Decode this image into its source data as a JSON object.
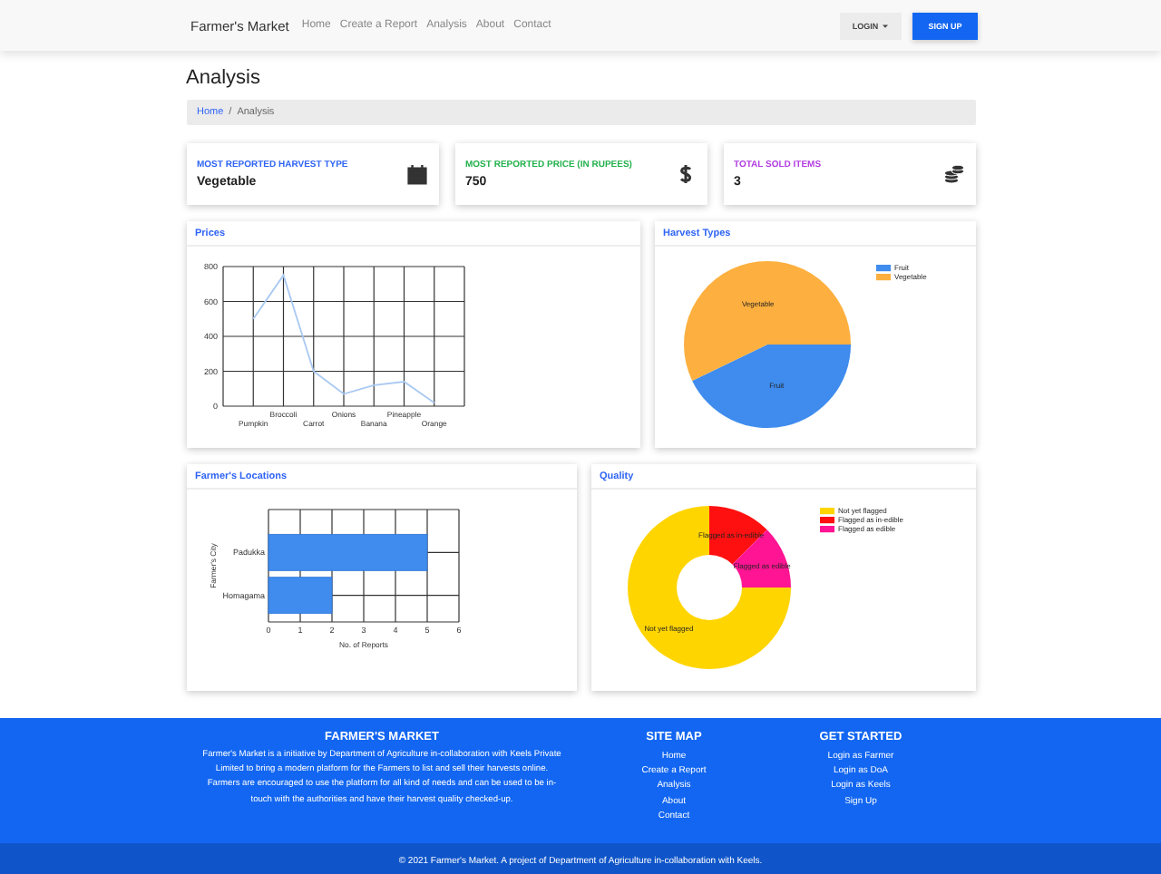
{
  "navbar": {
    "brand": "Farmer's Market",
    "links": [
      "Home",
      "Create a Report",
      "Analysis",
      "About",
      "Contact"
    ],
    "login": "LOGIN",
    "signup": "SIGN UP"
  },
  "page_title": "Analysis",
  "breadcrumb": {
    "separator": "/",
    "items": [
      {
        "label": "Home",
        "active": false
      },
      {
        "label": "Analysis",
        "active": true
      }
    ]
  },
  "stats": [
    {
      "label": "MOST REPORTED HARVEST TYPE",
      "value": "Vegetable",
      "color": "#2f64f5"
    },
    {
      "label": "MOST REPORTED PRICE (IN RUPEES)",
      "value": "750",
      "color": "#22b14c"
    },
    {
      "label": "TOTAL SOLD ITEMS",
      "value": "3",
      "color": "#b23ce0"
    }
  ],
  "prices": {
    "title": "Prices",
    "chart_data": {
      "type": "line",
      "categories": [
        "Pumpkin",
        "Broccoli",
        "Carrot",
        "Onions",
        "Banana",
        "Pineapple",
        "Orange"
      ],
      "series": [
        {
          "color": "#a9c9f2",
          "values": [
            500,
            750,
            200,
            70,
            120,
            140,
            20
          ]
        }
      ],
      "ylim": [
        0,
        800
      ],
      "yticks": [
        0,
        200,
        400,
        600,
        800
      ],
      "grid": true
    }
  },
  "harvest_types": {
    "title": "Harvest Types",
    "chart_data": {
      "type": "pie",
      "categories": [
        "Fruit",
        "Vegetable"
      ],
      "values": [
        42.86,
        57.14
      ],
      "colors": [
        "#3f8cee",
        "#fdb03f"
      ],
      "legend": true
    },
    "slice_labels": [
      "Fruit",
      "Vegetable"
    ]
  },
  "locations": {
    "title": "Farmer's Locations",
    "chart_data": {
      "type": "bar",
      "orientation": "horizontal",
      "categories": [
        "Padukka",
        "Homagama"
      ],
      "series": [
        {
          "color": "#3f8cee",
          "values": [
            5,
            2
          ]
        }
      ],
      "xlabel": "No. of Reports",
      "ylabel": "Farmer's City",
      "xlim": [
        0,
        6
      ],
      "xticks": [
        0,
        1,
        2,
        3,
        4,
        5,
        6
      ],
      "grid": true
    }
  },
  "quality": {
    "title": "Quality",
    "chart_data": {
      "type": "donut",
      "categories": [
        "Not yet flagged",
        "Flagged as in-edible",
        "Flagged as edible"
      ],
      "values": [
        75,
        12.5,
        12.5
      ],
      "colors": [
        "#ffd500",
        "#ff1010",
        "#ff1493"
      ],
      "legend": true
    },
    "slice_labels": [
      "Not yet flagged",
      "Flagged as in-edible",
      "Flagged as edible"
    ]
  },
  "footer": {
    "about": {
      "title": "FARMER'S MARKET",
      "text": "Farmer's Market is a initiative by Department of Agriculture in-collaboration with Keels Private Limited to bring a modern platform for the Farmers to list and sell their harvests online. Farmers are encouraged to use the platform for all kind of needs and can be used to be in-touch with the authorities and have their harvest quality checked-up."
    },
    "site_map": {
      "title": "SITE MAP",
      "links": [
        "Home",
        "Create a Report",
        "Analysis",
        "About",
        "Contact"
      ]
    },
    "get_started": {
      "title": "GET STARTED",
      "links": [
        "Login as Farmer",
        "Login as DoA",
        "Login as Keels",
        "Sign Up"
      ]
    },
    "copyright": "© 2021 Farmer's Market. A project of Department of Agriculture in-collaboration with Keels."
  }
}
